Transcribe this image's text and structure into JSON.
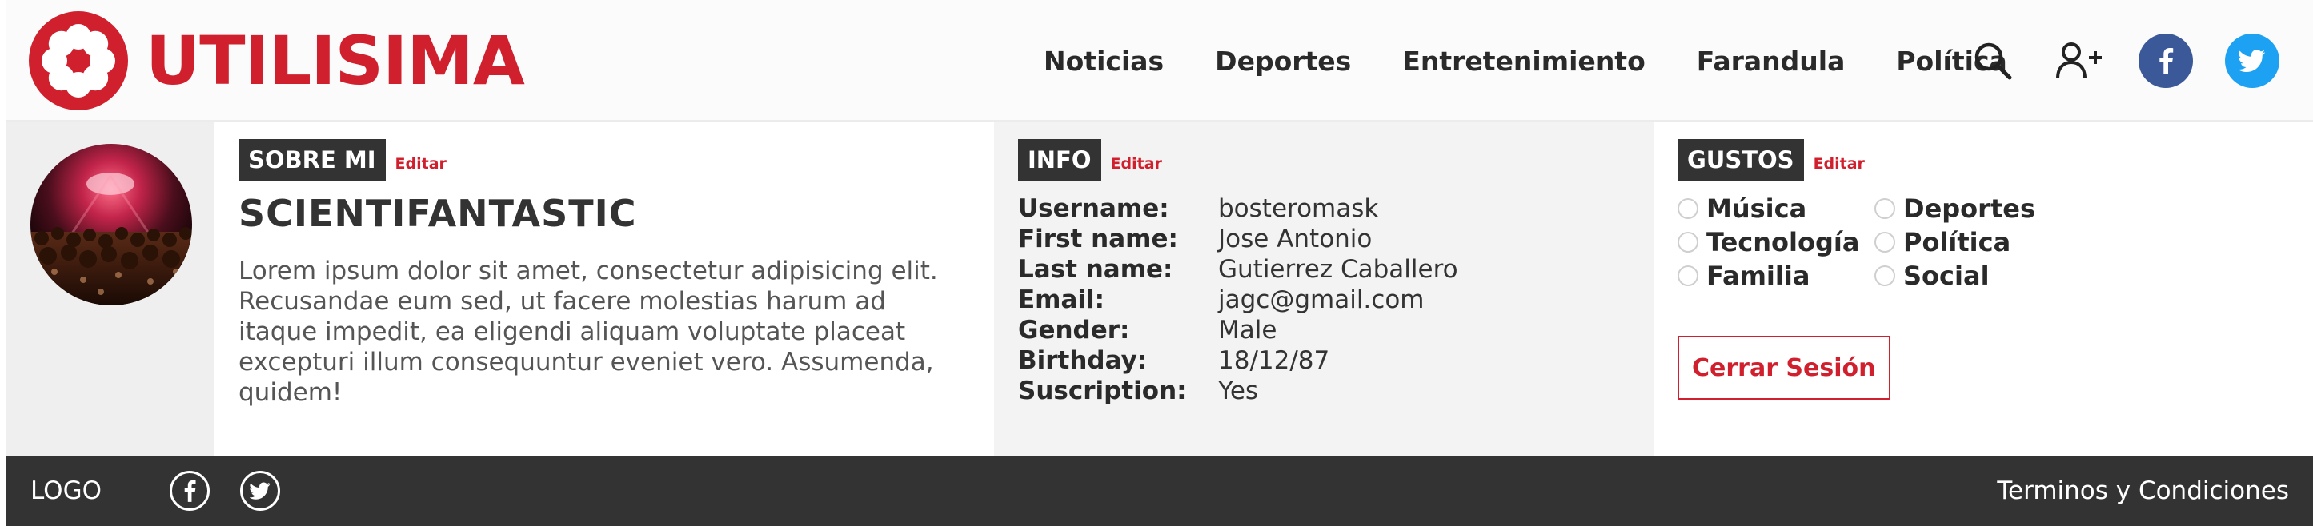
{
  "brand": {
    "name": "UTILISIMA",
    "color": "#d0202e",
    "logo_icon": "flower-icon"
  },
  "nav": {
    "items": [
      "Noticias",
      "Deportes",
      "Entretenimiento",
      "Farandula",
      "Política"
    ]
  },
  "header_icons": [
    "search-icon",
    "google-plus-icon",
    "facebook-icon",
    "twitter-icon"
  ],
  "about": {
    "tag": "SOBRE MI",
    "edit_label": "Editar",
    "username": "SCIENTIFANTASTIC",
    "bio": "Lorem ipsum dolor sit amet, consectetur adipisicing elit. Recusandae eum sed, ut facere molestias harum ad itaque impedit, ea eligendi aliquam voluptate placeat excepturi illum consequuntur eveniet vero. Assumenda, quidem!"
  },
  "info": {
    "tag": "INFO",
    "edit_label": "Editar",
    "rows": [
      {
        "label": "Username:",
        "value": "bosteromask"
      },
      {
        "label": "First name:",
        "value": "Jose Antonio"
      },
      {
        "label": "Last name:",
        "value": "Gutierrez Caballero"
      },
      {
        "label": "Email:",
        "value": "jagc@gmail.com"
      },
      {
        "label": "Gender:",
        "value": "Male"
      },
      {
        "label": "Birthday:",
        "value": "18/12/87"
      },
      {
        "label": "Suscription:",
        "value": "Yes"
      }
    ]
  },
  "likes": {
    "tag": "GUSTOS",
    "edit_label": "Editar",
    "options": [
      "Música",
      "Deportes",
      "Tecnología",
      "Política",
      "Familia",
      "Social"
    ],
    "logout_label": "Cerrar Sesión"
  },
  "footer": {
    "logo": "LOGO",
    "icons": [
      "facebook-icon",
      "twitter-icon"
    ],
    "terms": "Terminos y Condiciones"
  }
}
